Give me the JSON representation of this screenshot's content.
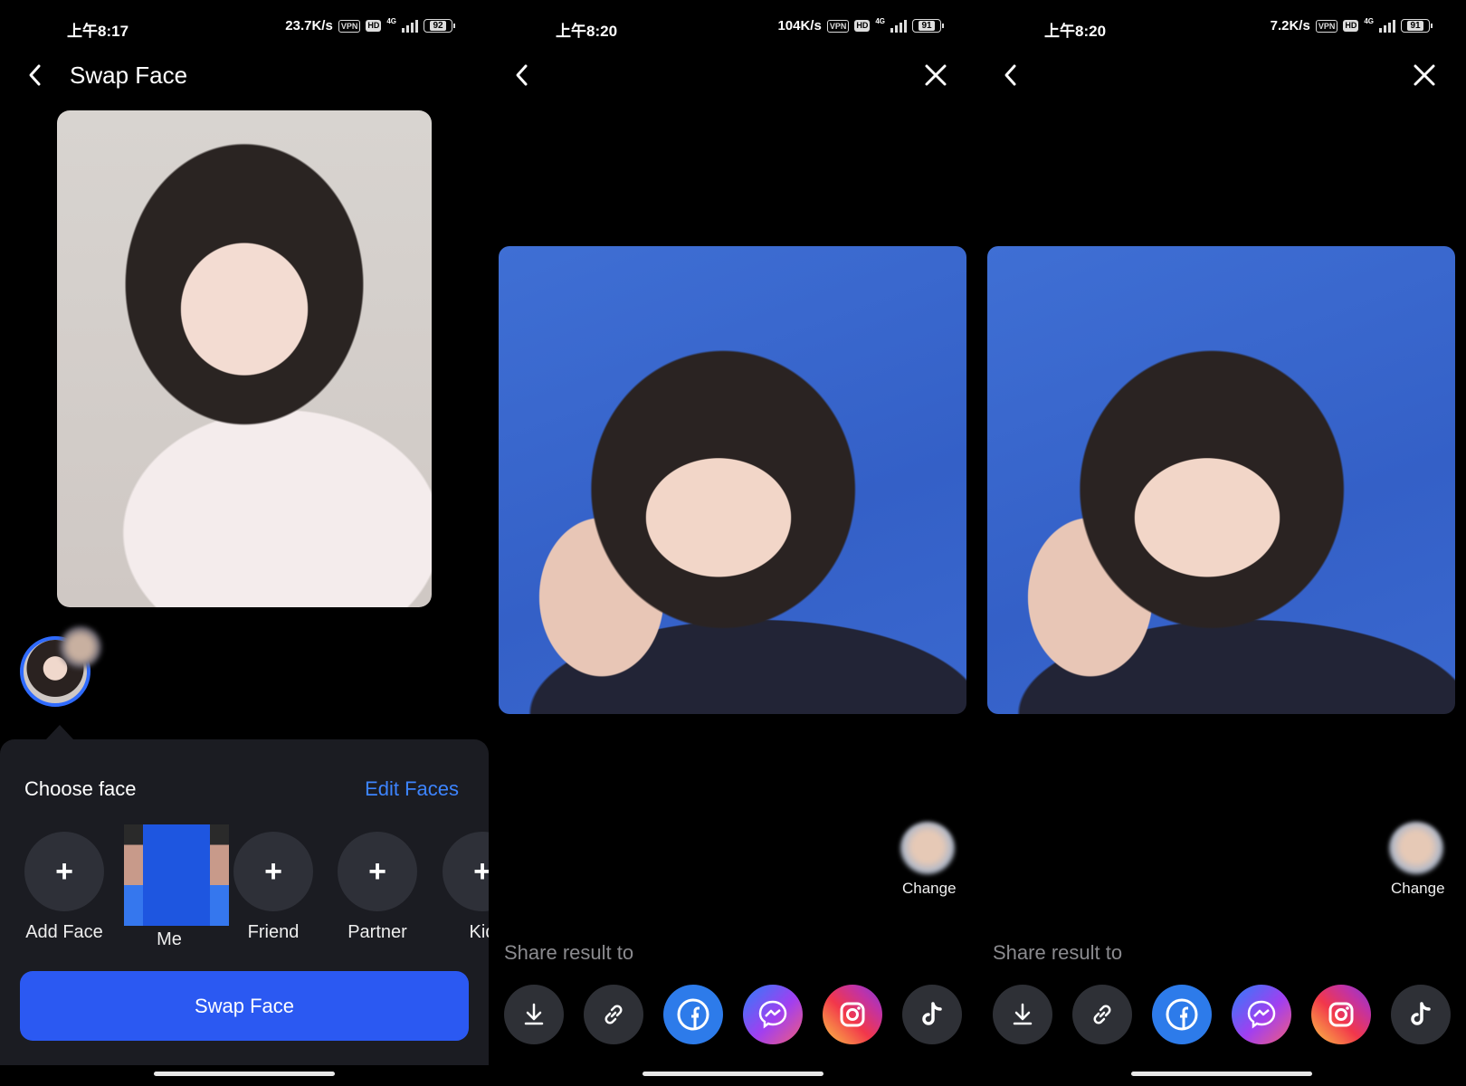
{
  "screen1": {
    "status": {
      "time": "上午8:17",
      "speed": "23.7K/s",
      "vpn": "VPN",
      "hd": "HD",
      "net": "4G",
      "battery": "92"
    },
    "title": "Swap Face",
    "choose_label": "Choose face",
    "edit_faces": "Edit Faces",
    "faces": [
      {
        "label": "Add Face",
        "icon": "+"
      },
      {
        "label": "Me",
        "icon": ""
      },
      {
        "label": "Friend",
        "icon": "+"
      },
      {
        "label": "Partner",
        "icon": "+"
      },
      {
        "label": "Kid",
        "icon": "+"
      }
    ],
    "swap_button": "Swap Face"
  },
  "screen2": {
    "status": {
      "time": "上午8:20",
      "speed": "104K/s",
      "vpn": "VPN",
      "hd": "HD",
      "net": "4G",
      "battery": "91"
    },
    "change_label": "Change",
    "share_label": "Share result to"
  },
  "screen3": {
    "status": {
      "time": "上午8:20",
      "speed": "7.2K/s",
      "vpn": "VPN",
      "hd": "HD",
      "net": "4G",
      "battery": "91"
    },
    "change_label": "Change",
    "share_label": "Share result to"
  },
  "share_targets": [
    "download-icon",
    "link-icon",
    "facebook-icon",
    "messenger-icon",
    "instagram-icon",
    "tiktok-icon"
  ],
  "colors": {
    "accent": "#2b59f2",
    "link": "#3d84ff",
    "sheet": "#1b1c22"
  }
}
